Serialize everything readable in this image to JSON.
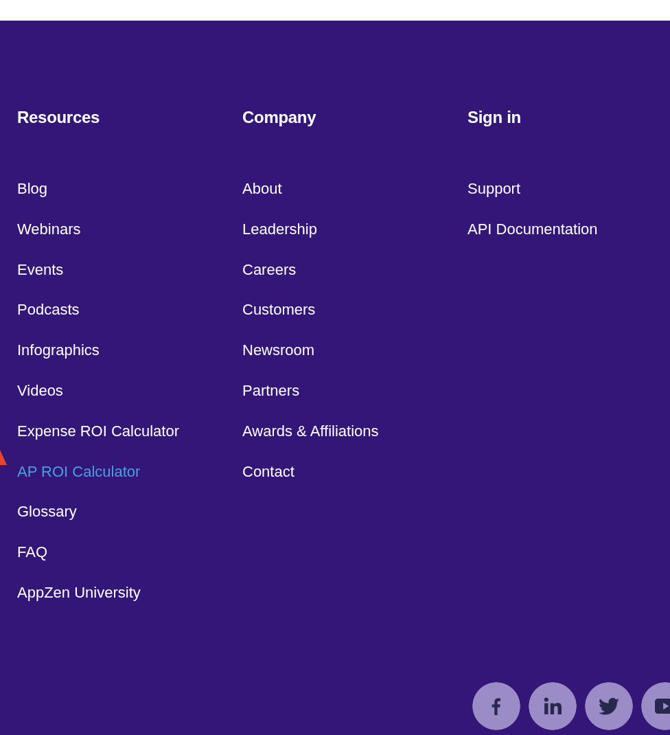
{
  "columns": [
    {
      "heading": "Resources",
      "links": [
        {
          "label": "Blog",
          "highlighted": false
        },
        {
          "label": "Webinars",
          "highlighted": false
        },
        {
          "label": "Events",
          "highlighted": false
        },
        {
          "label": "Podcasts",
          "highlighted": false
        },
        {
          "label": "Infographics",
          "highlighted": false
        },
        {
          "label": "Videos",
          "highlighted": false
        },
        {
          "label": "Expense ROI Calculator",
          "highlighted": false
        },
        {
          "label": "AP ROI Calculator",
          "highlighted": true
        },
        {
          "label": "Glossary",
          "highlighted": false
        },
        {
          "label": "FAQ",
          "highlighted": false
        },
        {
          "label": "AppZen University",
          "highlighted": false
        }
      ]
    },
    {
      "heading": "Company",
      "links": [
        {
          "label": "About",
          "highlighted": false
        },
        {
          "label": "Leadership",
          "highlighted": false
        },
        {
          "label": "Careers",
          "highlighted": false
        },
        {
          "label": "Customers",
          "highlighted": false
        },
        {
          "label": "Newsroom",
          "highlighted": false
        },
        {
          "label": "Partners",
          "highlighted": false
        },
        {
          "label": "Awards & Affiliations",
          "highlighted": false
        },
        {
          "label": "Contact",
          "highlighted": false
        }
      ]
    },
    {
      "heading": "Sign in",
      "links": [
        {
          "label": "Support",
          "highlighted": false
        },
        {
          "label": "API Documentation",
          "highlighted": false
        }
      ]
    }
  ],
  "social_links": [
    {
      "kind": "facebook"
    },
    {
      "kind": "linkedin"
    },
    {
      "kind": "twitter"
    },
    {
      "kind": "youtube"
    }
  ]
}
